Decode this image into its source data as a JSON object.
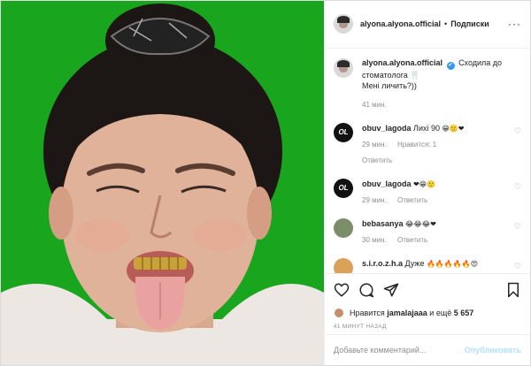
{
  "post": {
    "username": "alyona.alyona.official",
    "follow_label": "Подписки",
    "more_label": "···",
    "caption": {
      "username": "alyona.alyona.official",
      "verified_mark": "✔",
      "text_line1": "Сходила до",
      "text_line2": "стоматолога 🦷",
      "text_line3": "Мені личить?))",
      "time": "41 мин."
    }
  },
  "comments": [
    {
      "avatar_text": "OL",
      "username": "obuv_lagoda",
      "text": "Лихі 90",
      "emoji": "😁🙂❤",
      "time": "29 мин.",
      "likes": "Нравится: 1",
      "reply": "Ответить",
      "heart": "♡"
    },
    {
      "avatar_text": "OL",
      "username": "obuv_lagoda",
      "text": "",
      "emoji": "❤😁🙂",
      "time": "29 мин.",
      "likes": "",
      "reply": "Ответить",
      "heart": "♡"
    },
    {
      "avatar_text": "",
      "username": "bebasanya",
      "text": "",
      "emoji": "😂😂😂❤",
      "time": "30 мин.",
      "likes": "",
      "reply": "Ответить",
      "heart": "♡"
    },
    {
      "avatar_text": "",
      "username": "s.i.r.o.z.h.a",
      "text": "Дуже",
      "emoji": "🔥🔥🔥🔥🔥😍",
      "time": "",
      "likes": "",
      "reply": "",
      "heart": "♡"
    }
  ],
  "likes": {
    "prefix": "Нравится",
    "user": "jamalajaaa",
    "middle": "и ещё",
    "count": "5 657"
  },
  "posted_time": "41 МИНУТ НАЗАД",
  "add_comment": {
    "placeholder": "Добавьте комментарий...",
    "publish_label": "Опубликовать"
  },
  "colors": {
    "background": "#1aa51e",
    "link_blue": "#3897f0",
    "publish_disabled": "#b2dffc",
    "heart_red": "#ed4956"
  }
}
